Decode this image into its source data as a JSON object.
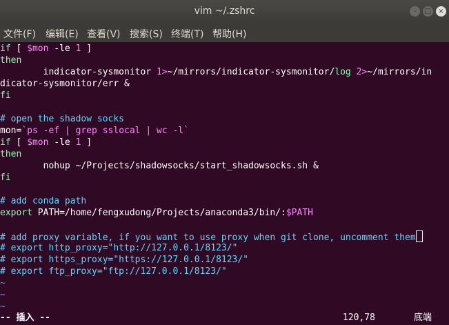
{
  "window": {
    "title": "vim ~/.zshrc",
    "buttons": [
      "-",
      "□",
      "×"
    ]
  },
  "menu": [
    "文件(F)",
    "编辑(E)",
    "查看(V)",
    "搜索(S)",
    "终端(T)",
    "帮助(H)"
  ],
  "lines": [
    {
      "segs": [
        [
          "if ",
          "kw"
        ],
        [
          "[ ",
          "br"
        ],
        [
          "$mon",
          "var"
        ],
        [
          " -le ",
          "br"
        ],
        [
          "1",
          "num"
        ],
        [
          " ]",
          "br"
        ]
      ]
    },
    {
      "segs": [
        [
          "then",
          "kw"
        ]
      ]
    },
    {
      "segs": [
        [
          "        indicator-sysmonitor ",
          "br"
        ],
        [
          "1>",
          "num"
        ],
        [
          "~/mirrors/indicator-sysmonitor/",
          "br"
        ],
        [
          "log",
          "kw"
        ],
        [
          " ",
          "br"
        ],
        [
          "2>",
          "num"
        ],
        [
          "~/mirrors/in",
          "br"
        ]
      ]
    },
    {
      "segs": [
        [
          "dicator-sysmonitor/err &",
          "br"
        ]
      ]
    },
    {
      "segs": [
        [
          "fi",
          "kw"
        ]
      ]
    },
    {
      "segs": []
    },
    {
      "segs": [
        [
          "# open the shadow socks",
          "cmt"
        ]
      ]
    },
    {
      "segs": [
        [
          "mon=",
          "br"
        ],
        [
          "`ps -ef | grep sslocal | wc -l`",
          "var"
        ]
      ]
    },
    {
      "segs": [
        [
          "if ",
          "kw"
        ],
        [
          "[ ",
          "br"
        ],
        [
          "$mon",
          "var"
        ],
        [
          " -le ",
          "br"
        ],
        [
          "1",
          "num"
        ],
        [
          " ]",
          "br"
        ]
      ]
    },
    {
      "segs": [
        [
          "then",
          "kw"
        ]
      ]
    },
    {
      "segs": [
        [
          "        nohup ~/Projects/shadowsocks/start_shadowsocks.sh &",
          "br"
        ]
      ]
    },
    {
      "segs": [
        [
          "fi",
          "kw"
        ]
      ]
    },
    {
      "segs": []
    },
    {
      "segs": [
        [
          "# add conda path",
          "cmt"
        ]
      ]
    },
    {
      "segs": [
        [
          "export",
          "kw"
        ],
        [
          " PATH=/home/fengxudong/Projects/anaconda3/bin/:",
          "br"
        ],
        [
          "$PATH",
          "var"
        ]
      ]
    },
    {
      "segs": []
    },
    {
      "segs": [
        [
          "# add proxy variable, if you want to use proxy when git clone, uncomment them",
          "cmt"
        ]
      ],
      "cursor": true
    },
    {
      "segs": [
        [
          "# export http_proxy=\"http://127.0.0.1/8123/\"",
          "cmt"
        ]
      ]
    },
    {
      "segs": [
        [
          "# export https_proxy=\"https://127.0.0.1/8123/\"",
          "cmt"
        ]
      ]
    },
    {
      "segs": [
        [
          "# export ftp_proxy=\"ftp://127.0.0.1/8123/\"",
          "cmt"
        ]
      ]
    },
    {
      "segs": [
        [
          "~",
          "tilde"
        ]
      ]
    },
    {
      "segs": [
        [
          "~",
          "tilde"
        ]
      ]
    },
    {
      "segs": [
        [
          "~",
          "tilde"
        ]
      ]
    }
  ],
  "status": {
    "mode": "-- 插入 --",
    "position": "120,78",
    "scroll": "底端"
  },
  "colors": {
    "background": "#300a24",
    "keyword": "#87ffaf",
    "variable": "#ff87ff",
    "comment": "#5fd7ff",
    "tilde": "#8787d7"
  }
}
